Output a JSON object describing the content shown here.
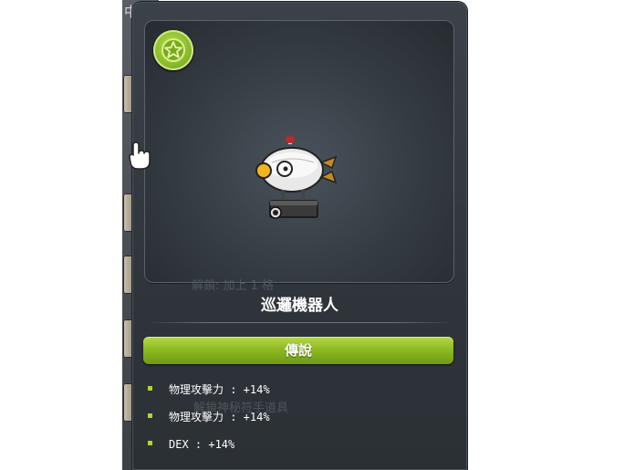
{
  "background": {
    "window_title": "中的道具"
  },
  "tooltip": {
    "item_name": "巡邏機器人",
    "rarity": "傳說",
    "ghost_text_1": "解鎖: 加上 1 格",
    "ghost_text_2": "解鎖神秘符手道具",
    "potentials": [
      {
        "text": "物理攻擊力 : +14%"
      },
      {
        "text": "物理攻擊力 : +14%"
      },
      {
        "text": "DEX : +14%"
      }
    ]
  },
  "colors": {
    "rarity_legendary": "#8fbb22",
    "panel_bg": "#2f353b"
  },
  "icons": {
    "badge": "star-icon",
    "cursor": "hand-cursor-icon",
    "item": "patrol-robot-icon"
  }
}
